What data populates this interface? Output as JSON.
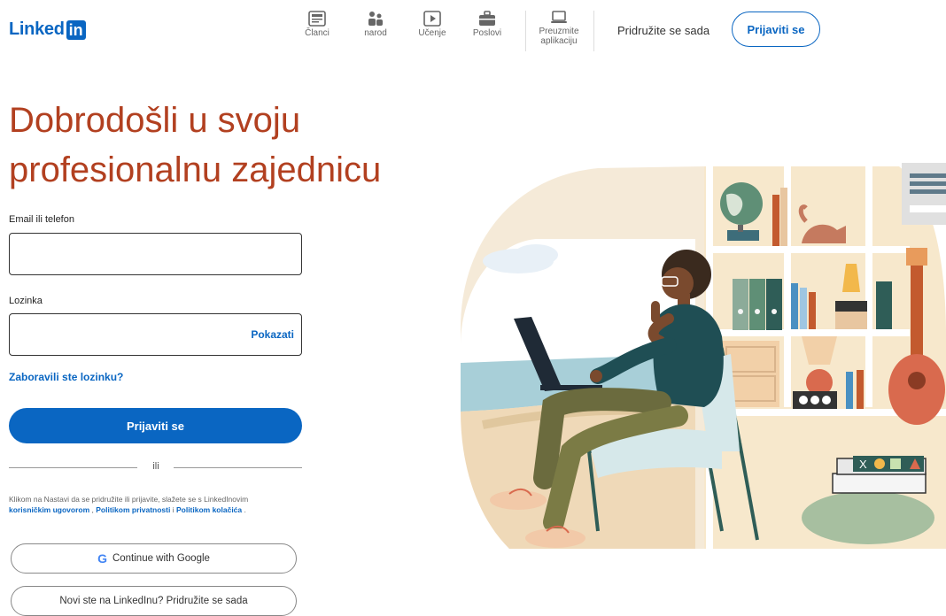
{
  "header": {
    "logo_text": "Linked",
    "logo_box": "in",
    "nav": [
      {
        "label": "Članci",
        "icon": "articles-icon"
      },
      {
        "label": "narod",
        "icon": "people-icon"
      },
      {
        "label": "Učenje",
        "icon": "learning-icon"
      },
      {
        "label": "Poslovi",
        "icon": "jobs-icon"
      },
      {
        "label_line1": "Preuzmite",
        "label_line2": "aplikaciju",
        "icon": "laptop-icon"
      }
    ],
    "join_label": "Pridružite se sada",
    "signin_label": "Prijaviti se"
  },
  "headline": {
    "line1": "Dobrodošli u svoju",
    "line2": "profesionalnu zajednicu"
  },
  "form": {
    "email_label": "Email ili telefon",
    "email_value": "",
    "password_label": "Lozinka",
    "password_value": "",
    "show_label": "Pokazati",
    "forgot_label": "Zaboravili ste lozinku?",
    "submit_label": "Prijaviti se",
    "or_label": "ili",
    "legal_text": "Klikom na Nastavi da se pridružite ili prijavite, slažete se s LinkedInovim",
    "legal_link1": "korisničkim ugovorom",
    "legal_sep1": " , ",
    "legal_link2": "Politikom privatnosti",
    "legal_sep2": " i ",
    "legal_link3": "Politikom kolačića",
    "legal_end": " .",
    "google_label": "Continue with Google",
    "google_icon_glyph": "G",
    "new_user_label": "Novi ste na LinkedInu? Pridružite se sada"
  },
  "colors": {
    "brand": "#0a66c2",
    "headline": "#b24020"
  }
}
